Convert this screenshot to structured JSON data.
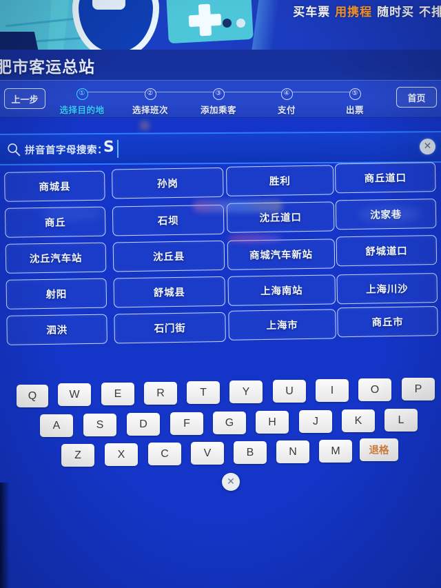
{
  "banner": {
    "text_parts": [
      "买车票",
      "用携程",
      "随时买 不排"
    ],
    "highlight_color": "#ff9a2e"
  },
  "header": {
    "station_title": "肥市客运总站"
  },
  "stepbar": {
    "prev_label": "上一步",
    "home_label": "首页",
    "active_color": "#35c9ff",
    "steps": [
      {
        "num": "①",
        "label": "选择目的地"
      },
      {
        "num": "②",
        "label": "选择班次"
      },
      {
        "num": "③",
        "label": "添加乘客"
      },
      {
        "num": "④",
        "label": "支付"
      },
      {
        "num": "⑤",
        "label": "出票"
      }
    ],
    "active_index": 0
  },
  "search": {
    "icon": "search-icon",
    "label": "拼音首字母搜索：",
    "value": "S",
    "clear_icon": "✕"
  },
  "destinations": {
    "rows": [
      [
        "商城县",
        "孙岗",
        "胜利",
        "商丘道口"
      ],
      [
        "商丘",
        "石坝",
        "沈丘道口",
        "沈家巷"
      ],
      [
        "沈丘汽车站",
        "沈丘县",
        "商城汽车新站",
        "舒城道口"
      ],
      [
        "射阳",
        "舒城县",
        "上海南站",
        "上海川沙"
      ],
      [
        "泗洪",
        "石门街",
        "上海市",
        "商丘市"
      ]
    ]
  },
  "keyboard": {
    "rows": [
      [
        "Q",
        "W",
        "E",
        "R",
        "T",
        "Y",
        "U",
        "I",
        "O",
        "P"
      ],
      [
        "A",
        "S",
        "D",
        "F",
        "G",
        "H",
        "J",
        "K",
        "L"
      ],
      [
        "Z",
        "X",
        "C",
        "V",
        "B",
        "N",
        "M",
        "退格"
      ]
    ],
    "backspace_label": "退格",
    "backspace_color": "#d4823e",
    "close_icon": "✕"
  },
  "colors": {
    "screen_bg": "#1435c8",
    "title_bar": "#16309c",
    "step_bar": "#2546c9",
    "search_border": "#2f7bff",
    "key_face": "#f2f2f2"
  }
}
